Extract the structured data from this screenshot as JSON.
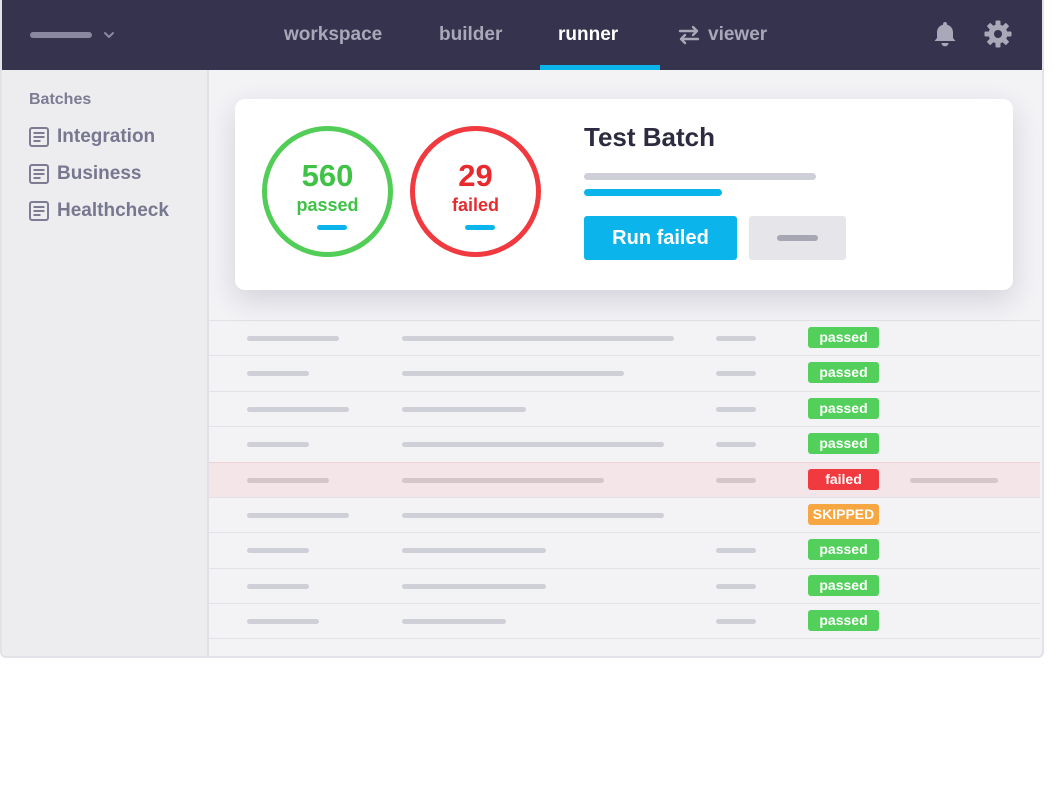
{
  "nav": {
    "tabs": [
      {
        "label": "workspace",
        "active": false
      },
      {
        "label": "builder",
        "active": false
      },
      {
        "label": "runner",
        "active": true
      },
      {
        "label": "viewer",
        "active": false,
        "icon": "swap-arrows-icon"
      }
    ],
    "icons": [
      "bell-icon",
      "gear-icon"
    ],
    "accent_color": "#0bb4ea",
    "bar_color": "#35334d"
  },
  "sidebar": {
    "title": "Batches",
    "items": [
      {
        "label": "Integration",
        "icon": "list-doc-icon"
      },
      {
        "label": "Business",
        "icon": "list-doc-icon"
      },
      {
        "label": "Healthcheck",
        "icon": "list-doc-icon"
      }
    ]
  },
  "summary": {
    "title": "Test Batch",
    "passed_count": "560",
    "passed_label": "passed",
    "failed_count": "29",
    "failed_label": "failed",
    "run_failed_label": "Run failed",
    "pass_color": "#52cd57",
    "fail_color": "#f03a3f"
  },
  "results": {
    "rows": [
      {
        "status": "passed",
        "label": "passed"
      },
      {
        "status": "passed",
        "label": "passed"
      },
      {
        "status": "passed",
        "label": "passed"
      },
      {
        "status": "passed",
        "label": "passed"
      },
      {
        "status": "failed",
        "label": "failed"
      },
      {
        "status": "skipped",
        "label": "SKIPPED"
      },
      {
        "status": "passed",
        "label": "passed"
      },
      {
        "status": "passed",
        "label": "passed"
      },
      {
        "status": "passed",
        "label": "passed"
      }
    ]
  }
}
